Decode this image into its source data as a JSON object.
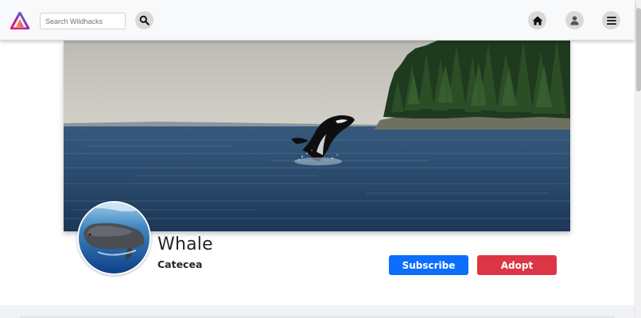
{
  "header": {
    "search_placeholder": "Search Wildhacks",
    "icons": {
      "logo": "wildhacks-logo",
      "search": "search-icon",
      "home": "home-icon",
      "profile": "user-icon",
      "menu": "menu-icon"
    }
  },
  "profile": {
    "name": "Whale",
    "subtitle": "Catecea",
    "subscribe_label": "Subscribe",
    "adopt_label": "Adopt"
  },
  "colors": {
    "subscribe": "#0d6efd",
    "adopt": "#dc3545",
    "topbar": "#f8f9fa",
    "icon_bg": "#d9d9d9"
  }
}
